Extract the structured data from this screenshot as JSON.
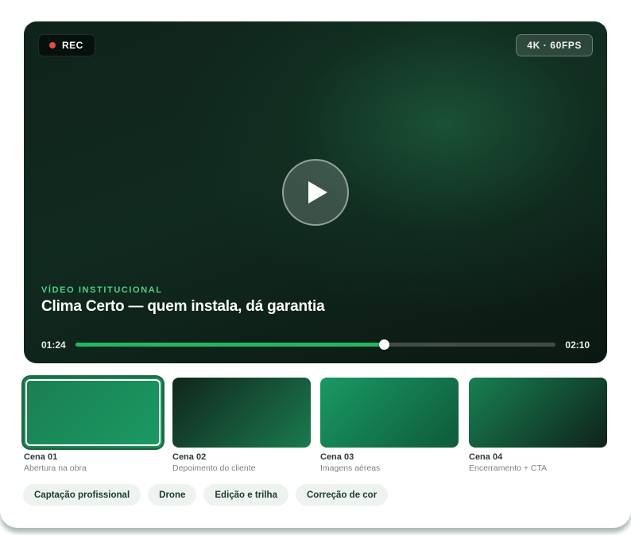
{
  "player": {
    "rec_label": "REC",
    "quality_label": "4K · 60FPS",
    "eyebrow": "VÍDEO INSTITUCIONAL",
    "title": "Clima Certo — quem instala, dá garantia",
    "time_current": "01:24",
    "time_total": "02:10",
    "progress_fraction": 0.643,
    "colors": {
      "accent": "#22b862",
      "rec": "#e84b4b",
      "eyebrow": "#4ccf86"
    }
  },
  "scenes": [
    {
      "label": "Cena 01",
      "subtitle": "Abertura na obra",
      "active": true,
      "gradient": [
        "#1b7e52",
        "#1a9a63"
      ]
    },
    {
      "label": "Cena 02",
      "subtitle": "Depoimento do cliente",
      "active": false,
      "gradient": [
        "#11261c",
        "#1a7a4f"
      ]
    },
    {
      "label": "Cena 03",
      "subtitle": "Imagens aéreas",
      "active": false,
      "gradient": [
        "#199964",
        "#0f5a3a"
      ]
    },
    {
      "label": "Cena 04",
      "subtitle": "Encerramento + CTA",
      "active": false,
      "gradient": [
        "#178052",
        "#0f221a"
      ]
    }
  ],
  "tags": [
    "Captação profissional",
    "Drone",
    "Edição e trilha",
    "Correção de cor"
  ]
}
